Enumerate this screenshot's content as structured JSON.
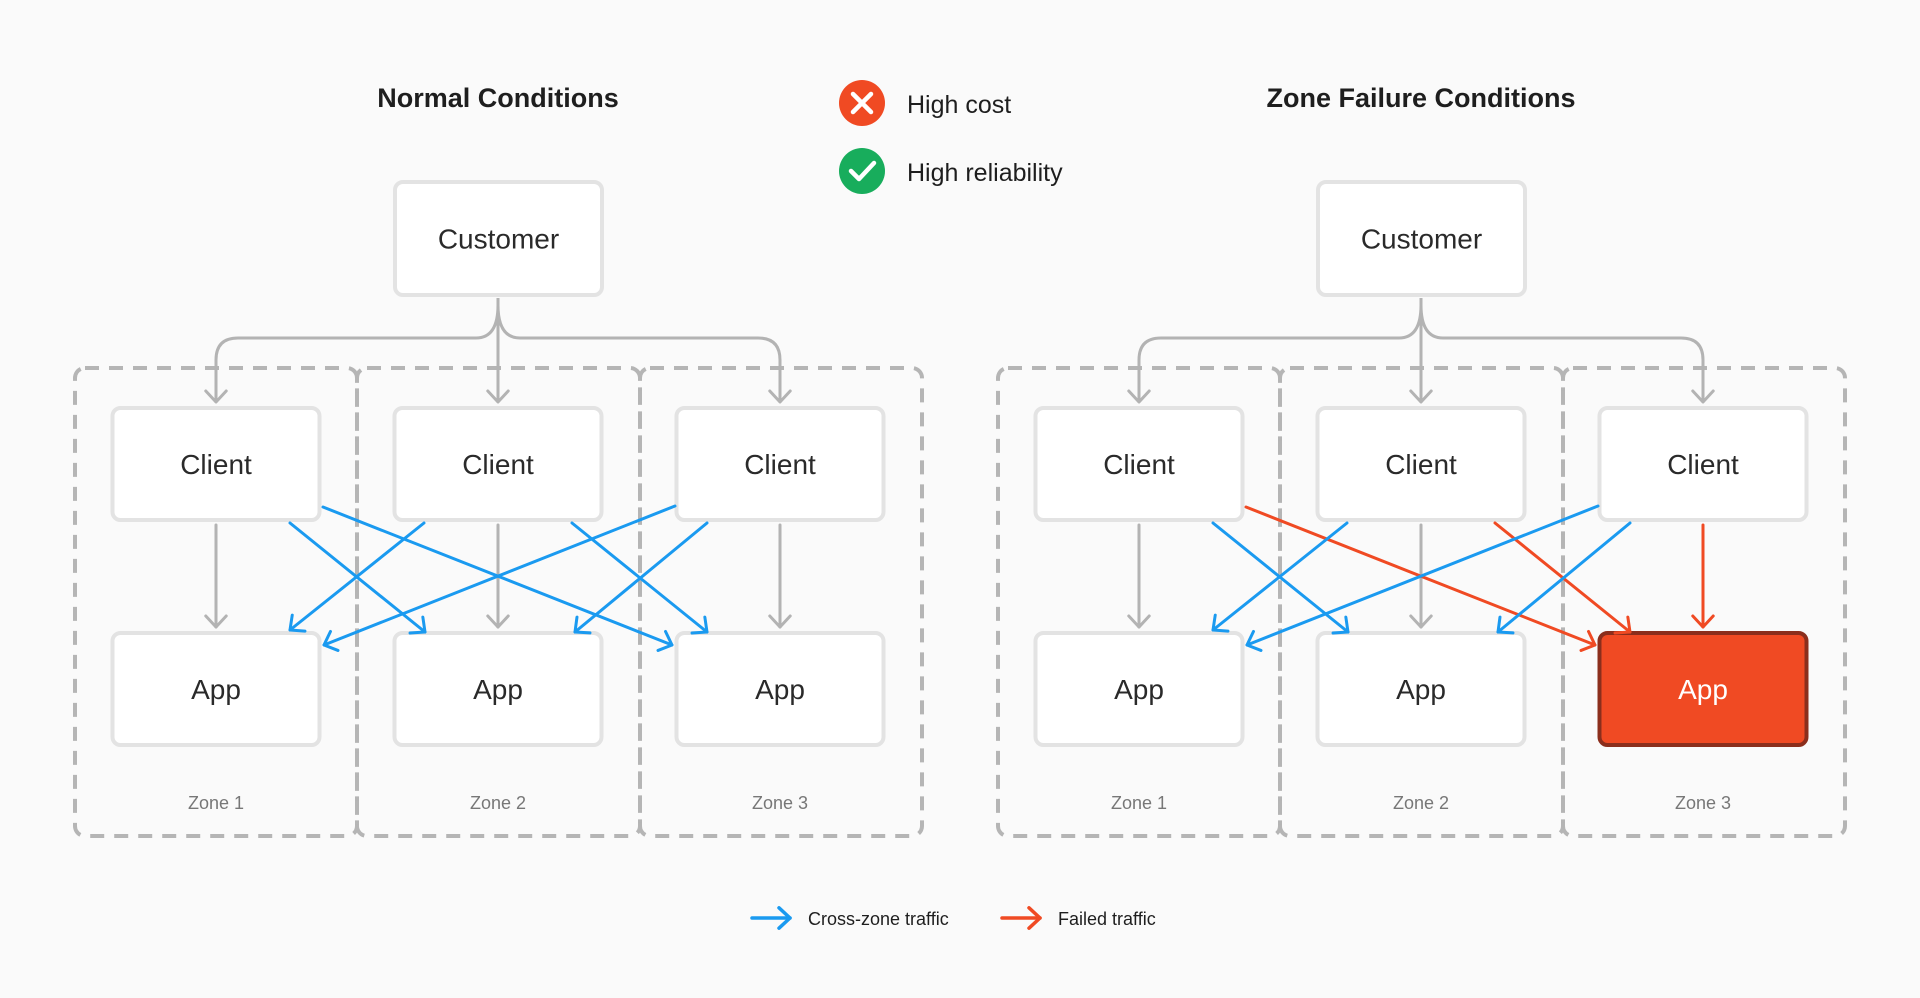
{
  "status_legend": [
    {
      "icon": "x-circle-icon",
      "label": "High cost",
      "color": "#F04A23"
    },
    {
      "icon": "check-circle-icon",
      "label": "High reliability",
      "color": "#18AD5C"
    }
  ],
  "colors": {
    "cross_zone": "#1A9AF0",
    "failed": "#F04A23",
    "failed_border": "#8B2E1C",
    "neutral_arrow": "#b3b3b3",
    "zone_border": "#b5b5b5",
    "box_border": "#e3e3e3"
  },
  "diagrams": [
    {
      "id": "normal",
      "title": "Normal Conditions",
      "customer_label": "Customer",
      "zones": [
        {
          "label": "Zone 1",
          "client": "Client",
          "app": "App",
          "app_failed": false
        },
        {
          "label": "Zone 2",
          "client": "Client",
          "app": "App",
          "app_failed": false
        },
        {
          "label": "Zone 3",
          "client": "Client",
          "app": "App",
          "app_failed": false
        }
      ],
      "connections": [
        {
          "from": 0,
          "to": 0,
          "type": "same-zone"
        },
        {
          "from": 1,
          "to": 1,
          "type": "same-zone"
        },
        {
          "from": 2,
          "to": 2,
          "type": "same-zone"
        },
        {
          "from": 0,
          "to": 1,
          "type": "cross-zone"
        },
        {
          "from": 0,
          "to": 2,
          "type": "cross-zone"
        },
        {
          "from": 1,
          "to": 0,
          "type": "cross-zone"
        },
        {
          "from": 1,
          "to": 2,
          "type": "cross-zone"
        },
        {
          "from": 2,
          "to": 0,
          "type": "cross-zone"
        },
        {
          "from": 2,
          "to": 1,
          "type": "cross-zone"
        }
      ]
    },
    {
      "id": "failure",
      "title": "Zone Failure Conditions",
      "customer_label": "Customer",
      "zones": [
        {
          "label": "Zone 1",
          "client": "Client",
          "app": "App",
          "app_failed": false
        },
        {
          "label": "Zone 2",
          "client": "Client",
          "app": "App",
          "app_failed": false
        },
        {
          "label": "Zone 3",
          "client": "Client",
          "app": "App",
          "app_failed": true
        }
      ],
      "connections": [
        {
          "from": 0,
          "to": 0,
          "type": "same-zone"
        },
        {
          "from": 1,
          "to": 1,
          "type": "same-zone"
        },
        {
          "from": 2,
          "to": 2,
          "type": "failed"
        },
        {
          "from": 0,
          "to": 1,
          "type": "cross-zone"
        },
        {
          "from": 0,
          "to": 2,
          "type": "failed"
        },
        {
          "from": 1,
          "to": 0,
          "type": "cross-zone"
        },
        {
          "from": 1,
          "to": 2,
          "type": "failed"
        },
        {
          "from": 2,
          "to": 0,
          "type": "cross-zone"
        },
        {
          "from": 2,
          "to": 1,
          "type": "cross-zone"
        }
      ]
    }
  ],
  "traffic_legend": [
    {
      "type": "cross-zone",
      "label": "Cross-zone traffic"
    },
    {
      "type": "failed",
      "label": "Failed traffic"
    }
  ]
}
